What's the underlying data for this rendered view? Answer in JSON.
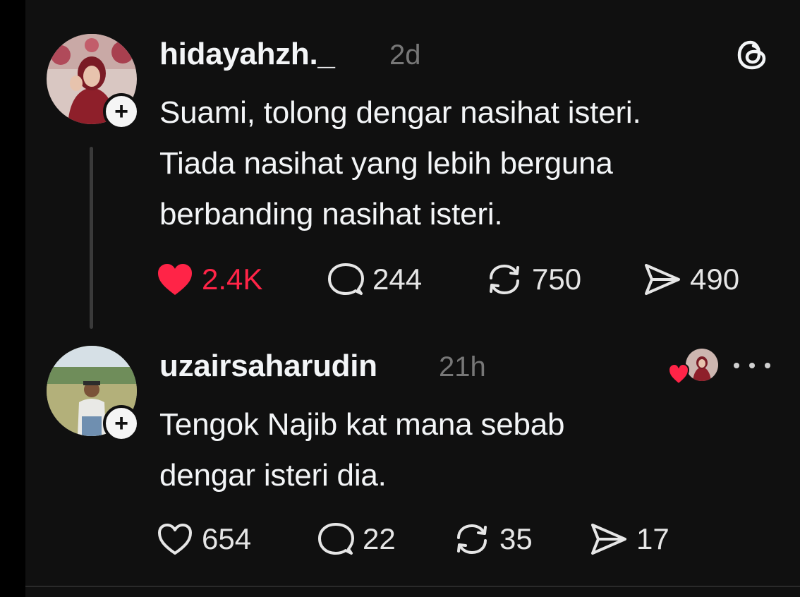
{
  "posts": [
    {
      "username": "hidayahzh._",
      "time": "2d",
      "text": [
        "Suami, tolong dengar nasihat isteri.",
        "Tiada nasihat yang lebih berguna",
        "berbanding nasihat isteri."
      ],
      "likes": "2.4K",
      "replies": "244",
      "reposts": "750",
      "shares": "490",
      "liked": true
    },
    {
      "username": "uzairsaharudin",
      "time": "21h",
      "text": [
        "Tengok Najib kat mana sebab",
        "dengar isteri dia."
      ],
      "likes": "654",
      "replies": "22",
      "reposts": "35",
      "shares": "17",
      "liked": false
    }
  ],
  "icons": {
    "app_logo": "threads-logo-icon",
    "follow": "plus-icon",
    "like": "heart-icon",
    "reply": "comment-bubble-icon",
    "repost": "repost-icon",
    "share": "send-icon",
    "more": "more-dots-icon"
  },
  "colors": {
    "background": "#101010",
    "text": "#f3f5f7",
    "muted": "#777777",
    "like_active": "#ff2447"
  }
}
